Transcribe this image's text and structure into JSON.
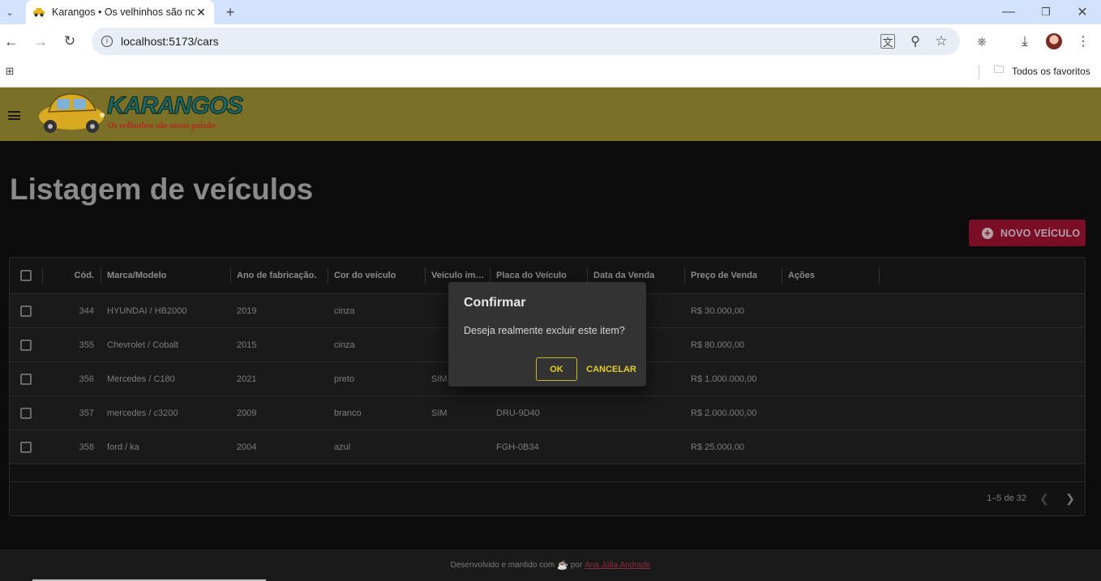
{
  "browser": {
    "tab_title": "Karangos • Os velhinhos são no",
    "url": "localhost:5173/cars",
    "bookmarks_label": "Todos os favoritos"
  },
  "app": {
    "logo_title": "KARANGOS",
    "logo_subtitle": "Os velhinhos são nossa paixão",
    "page_title": "Listagem de veículos",
    "new_button": "NOVO VEÍCULO"
  },
  "table": {
    "headers": [
      "Cód.",
      "Marca/Modelo",
      "Ano de fabricação.",
      "Cor do veículo",
      "Veículo im…",
      "Placa do Veículo",
      "Data da Venda",
      "Preço de Venda",
      "Ações"
    ],
    "rows": [
      {
        "code": "344",
        "model": "HYUNDAI / HB2000",
        "year": "2019",
        "color": "cinza",
        "imported": "",
        "plate": "",
        "sale_date": "",
        "price": "R$ 30.000,00"
      },
      {
        "code": "355",
        "model": "Chevrolet / Cobalt",
        "year": "2015",
        "color": "cinza",
        "imported": "",
        "plate": "",
        "sale_date": "",
        "price": "R$ 80.000,00"
      },
      {
        "code": "356",
        "model": "Mercedes / C180",
        "year": "2021",
        "color": "preto",
        "imported": "SIM",
        "plate": "",
        "sale_date": "",
        "price": "R$ 1.000.000,00"
      },
      {
        "code": "357",
        "model": "mercedes / c3200",
        "year": "2009",
        "color": "branco",
        "imported": "SIM",
        "plate": "DRU-9D40",
        "sale_date": "",
        "price": "R$ 2.000.000,00"
      },
      {
        "code": "358",
        "model": "ford / ka",
        "year": "2004",
        "color": "azul",
        "imported": "",
        "plate": "FGH-0B34",
        "sale_date": "",
        "price": "R$ 25.000,00"
      }
    ],
    "pagination": "1–5 de 32"
  },
  "dialog": {
    "title": "Confirmar",
    "message": "Deseja realmente excluir este item?",
    "ok": "OK",
    "cancel": "CANCELAR"
  },
  "footer": {
    "text": "Desenvolvido e mantido com",
    "by": "por",
    "author": "Ana Júlia Andrade"
  },
  "colors": {
    "appbar": "#7b7027",
    "accent_button": "#7a0e26",
    "dialog_action": "#e4cc2a"
  }
}
